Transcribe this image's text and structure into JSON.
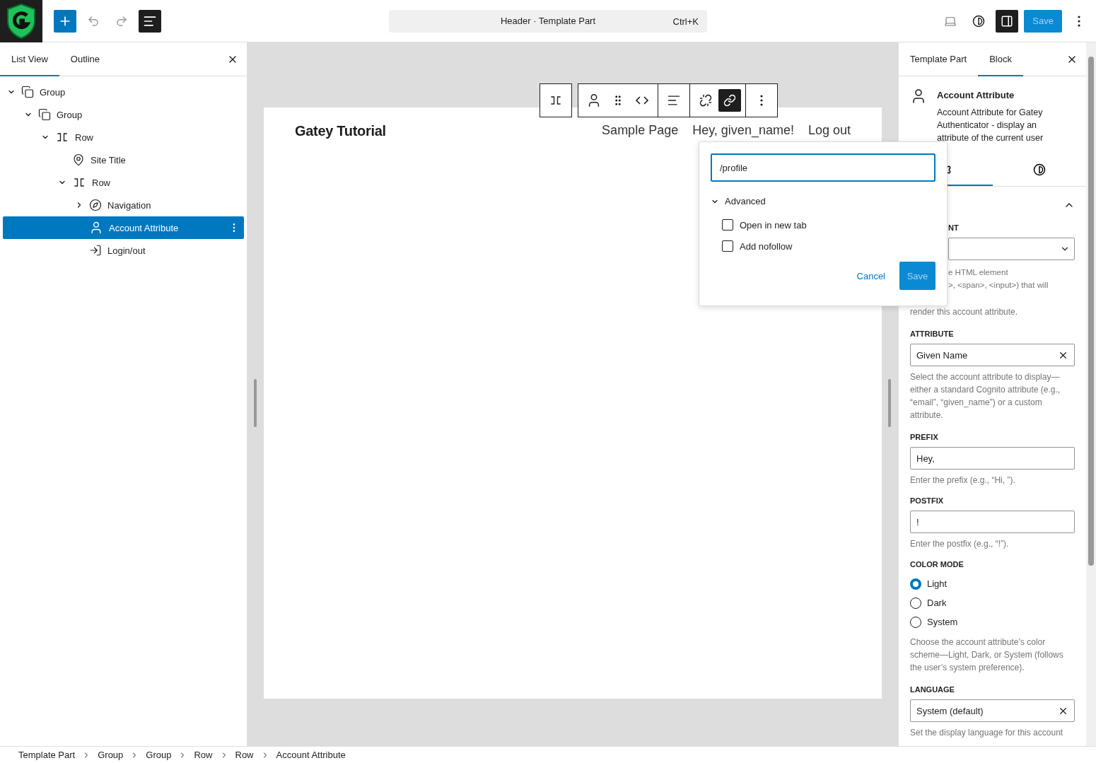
{
  "topbar": {
    "document_title": "Header · Template Part",
    "shortcut": "Ctrl+K",
    "save_button": "Save"
  },
  "list_panel": {
    "tabs": [
      {
        "label": "List View",
        "selected": true
      },
      {
        "label": "Outline",
        "selected": false
      }
    ],
    "tree": [
      {
        "label": "Group",
        "kind": "group",
        "expanded": true,
        "selected": false,
        "children": [
          {
            "label": "Group",
            "kind": "group",
            "expanded": true,
            "selected": false,
            "children": [
              {
                "label": "Row",
                "kind": "row",
                "expanded": true,
                "selected": false,
                "children": [
                  {
                    "label": "Site Title",
                    "kind": "site-title",
                    "selected": false
                  },
                  {
                    "label": "Row",
                    "kind": "row",
                    "expanded": true,
                    "selected": false,
                    "children": [
                      {
                        "label": "Navigation",
                        "kind": "navigation",
                        "expanded": false,
                        "selected": false
                      },
                      {
                        "label": "Account Attribute",
                        "kind": "account",
                        "selected": true
                      },
                      {
                        "label": "Login/out",
                        "kind": "login",
                        "selected": false
                      }
                    ]
                  }
                ]
              }
            ]
          }
        ]
      }
    ]
  },
  "canvas": {
    "site_title": "Gatey Tutorial",
    "nav": [
      "Sample Page",
      "Hey, given_name!",
      "Log out"
    ]
  },
  "link_popover": {
    "url": "/profile",
    "advanced": {
      "label": "Advanced",
      "expanded": true
    },
    "options": [
      {
        "label": "Open in new tab",
        "checked": false
      },
      {
        "label": "Add nofollow",
        "checked": false
      }
    ],
    "cancel": "Cancel",
    "save": "Save"
  },
  "sidebar": {
    "tabs": [
      {
        "label": "Template Part",
        "selected": false
      },
      {
        "label": "Block",
        "selected": true
      }
    ],
    "block": {
      "title": "Account Attribute",
      "description": "Account Attribute for Gatey Authenticator - display an attribute of the current user"
    },
    "element": {
      "label": "NT",
      "help_lines": [
        "e HTML element",
        ">, <span>, <input>) that will"
      ],
      "help_tail": "render this account attribute."
    },
    "attribute": {
      "label": "ATTRIBUTE",
      "value": "Given Name",
      "help": "Select the account attribute to display—either a standard Cognito attribute (e.g., “email”, “given_name”) or a custom attribute."
    },
    "prefix": {
      "label": "PREFIX",
      "value": "Hey,",
      "help": "Enter the prefix (e.g., “Hi, ”)."
    },
    "postfix": {
      "label": "POSTFIX",
      "value": "!",
      "help": "Enter the postfix (e.g., “!”)."
    },
    "color_mode": {
      "label": "COLOR MODE",
      "options": [
        {
          "label": "Light",
          "selected": true
        },
        {
          "label": "Dark",
          "selected": false
        },
        {
          "label": "System",
          "selected": false
        }
      ],
      "help": "Choose the account attribute’s color scheme—Light, Dark, or System (follows the user’s system preference)."
    },
    "language": {
      "label": "LANGUAGE",
      "value": "System (default)",
      "help": "Set the display language for this account"
    }
  },
  "breadcrumb": [
    "Template Part",
    "Group",
    "Group",
    "Row",
    "Row",
    "Account Attribute"
  ]
}
